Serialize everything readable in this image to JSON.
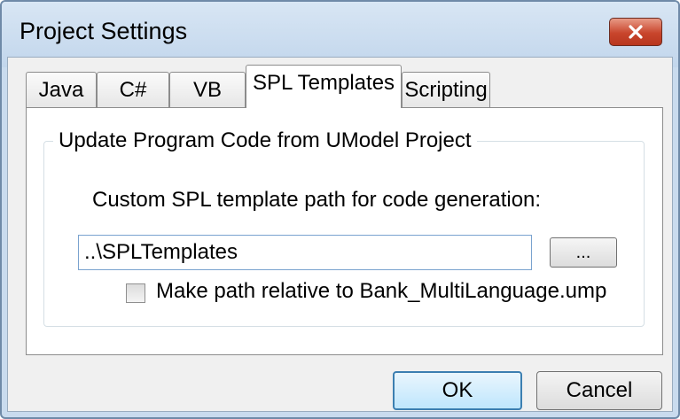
{
  "window": {
    "title": "Project Settings",
    "close_label": "✕"
  },
  "tabs": [
    {
      "label": "Java",
      "active": false
    },
    {
      "label": "C#",
      "active": false
    },
    {
      "label": "VB",
      "active": false
    },
    {
      "label": "SPL Templates",
      "active": true
    },
    {
      "label": "Scripting",
      "active": false
    }
  ],
  "group": {
    "title": "Update Program Code from UModel Project",
    "path_label": "Custom SPL template path for code generation:",
    "path_value": "..\\SPLTemplates",
    "browse_label": "...",
    "relative_checkbox": {
      "label": "Make path relative to Bank_MultiLanguage.ump",
      "checked": false
    }
  },
  "buttons": {
    "ok": "OK",
    "cancel": "Cancel"
  }
}
